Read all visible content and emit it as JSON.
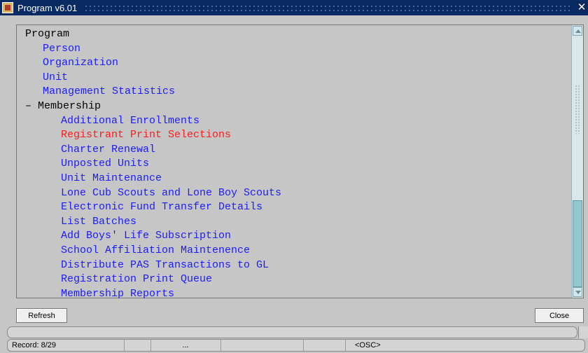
{
  "window": {
    "title": "Program v6.01",
    "close_glyph": "✕"
  },
  "tree": {
    "rows": [
      {
        "label": "Program",
        "level": 0,
        "selected": false
      },
      {
        "label": "Person",
        "level": 1,
        "selected": false
      },
      {
        "label": "Organization",
        "level": 1,
        "selected": false
      },
      {
        "label": "Unit",
        "level": 1,
        "selected": false
      },
      {
        "label": "Management Statistics",
        "level": 1,
        "selected": false
      },
      {
        "label": "– Membership",
        "level": 1,
        "selected": false,
        "expanded": true
      },
      {
        "label": "Additional Enrollments",
        "level": 2,
        "selected": false
      },
      {
        "label": "Registrant Print Selections",
        "level": 2,
        "selected": true
      },
      {
        "label": "Charter Renewal",
        "level": 2,
        "selected": false
      },
      {
        "label": "Unposted Units",
        "level": 2,
        "selected": false
      },
      {
        "label": "Unit Maintenance",
        "level": 2,
        "selected": false
      },
      {
        "label": "Lone Cub Scouts and Lone Boy Scouts",
        "level": 2,
        "selected": false
      },
      {
        "label": "Electronic Fund Transfer Details",
        "level": 2,
        "selected": false
      },
      {
        "label": "List Batches",
        "level": 2,
        "selected": false
      },
      {
        "label": "Add Boys' Life Subscription",
        "level": 2,
        "selected": false
      },
      {
        "label": "School Affiliation Maintenence",
        "level": 2,
        "selected": false
      },
      {
        "label": "Distribute PAS Transactions to GL",
        "level": 2,
        "selected": false
      },
      {
        "label": "Registration Print Queue",
        "level": 2,
        "selected": false
      },
      {
        "label": "Membership Reports",
        "level": 2,
        "selected": false
      }
    ]
  },
  "buttons": {
    "refresh": "Refresh",
    "close": "Close"
  },
  "status": {
    "record": "Record: 8/29",
    "ellipsis": "...",
    "osc": "<OSC>"
  },
  "colors": {
    "link": "#1b1bff",
    "selected": "#ff1a1a",
    "titlebar": "#0a2a63",
    "background": "#c6c6c6"
  },
  "icons": [
    "app-icon",
    "close-icon",
    "scroll-up-icon",
    "scroll-down-icon"
  ]
}
